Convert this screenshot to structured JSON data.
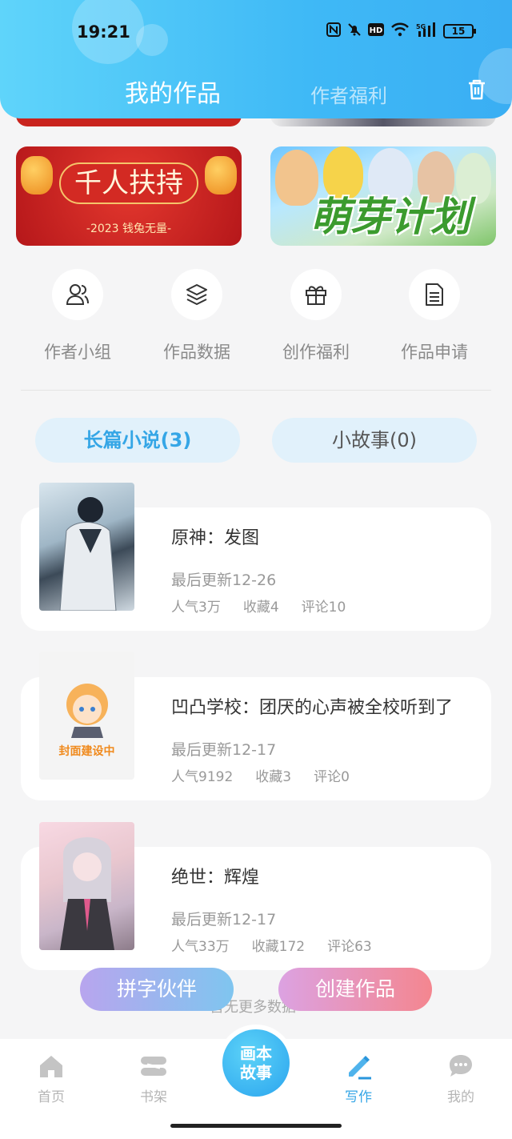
{
  "status_bar": {
    "time": "19:21",
    "battery": "15"
  },
  "header": {
    "tab_active": "我的作品",
    "tab_inactive": "作者福利"
  },
  "banners": [
    {
      "title": "千人扶持",
      "subtitle": "-2023 钱兔无量-"
    },
    {
      "title": "萌芽计划"
    }
  ],
  "quick_actions": [
    {
      "label": "作者小组",
      "icon": "users-icon"
    },
    {
      "label": "作品数据",
      "icon": "layers-icon"
    },
    {
      "label": "创作福利",
      "icon": "gift-icon"
    },
    {
      "label": "作品申请",
      "icon": "document-icon"
    }
  ],
  "tabs": {
    "long": "长篇小说(3)",
    "short": "小故事(0)"
  },
  "works": [
    {
      "title": "原神：发图",
      "updated": "最后更新12-26",
      "popularity": "人气3万",
      "favorites": "收藏4",
      "comments": "评论10",
      "cover_text": ""
    },
    {
      "title": "凹凸学校：团厌的心声被全校听到了",
      "updated": "最后更新12-17",
      "popularity": "人气9192",
      "favorites": "收藏3",
      "comments": "评论0",
      "cover_text": "封面建设中"
    },
    {
      "title": "绝世：辉煌",
      "updated": "最后更新12-17",
      "popularity": "人气33万",
      "favorites": "收藏172",
      "comments": "评论63",
      "cover_text": ""
    }
  ],
  "floating_buttons": {
    "partner": "拼字伙伴",
    "create": "创建作品"
  },
  "footer_text": "暂无更多数据",
  "bottom_nav": [
    {
      "label": "首页",
      "icon": "home-icon"
    },
    {
      "label": "书架",
      "icon": "bookshelf-icon"
    },
    {
      "label": "画本故事",
      "icon": "center-icon"
    },
    {
      "label": "写作",
      "icon": "pen-icon"
    },
    {
      "label": "我的",
      "icon": "chat-icon"
    }
  ],
  "colors": {
    "accent": "#35a6e6",
    "header": "#3fb9f6",
    "active_nav": "#35a6e6",
    "inactive_nav": "#b5b5b5"
  }
}
